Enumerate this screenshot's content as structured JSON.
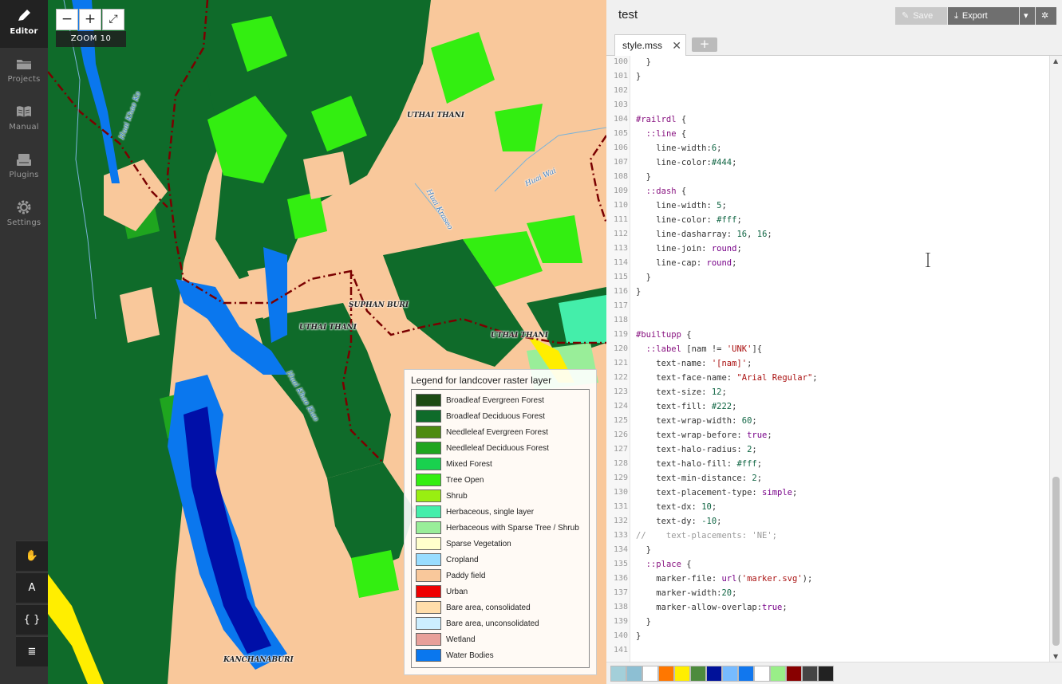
{
  "sidebar": {
    "items": [
      {
        "label": "Editor",
        "icon": "pencil-icon",
        "active": true
      },
      {
        "label": "Projects",
        "icon": "folder-icon",
        "active": false
      },
      {
        "label": "Manual",
        "icon": "book-icon",
        "active": false
      },
      {
        "label": "Plugins",
        "icon": "plugin-icon",
        "active": false
      },
      {
        "label": "Settings",
        "icon": "gear-icon",
        "active": false
      }
    ],
    "tools": [
      {
        "icon": "hand-icon",
        "glyph": "✋"
      },
      {
        "icon": "font-icon",
        "glyph": "A"
      },
      {
        "icon": "braces-icon",
        "glyph": "{ }"
      },
      {
        "icon": "layers-icon",
        "glyph": "≣"
      }
    ]
  },
  "map": {
    "zoom_out": "−",
    "zoom_in": "+",
    "fullscreen": "⤢",
    "zoom_label": "ZOOM 10",
    "labels": [
      {
        "text": "UTHAI THANI",
        "kind": "place"
      },
      {
        "text": "SUPHAN BURI",
        "kind": "place"
      },
      {
        "text": "UTHAI THANI",
        "kind": "place"
      },
      {
        "text": "UTHAI THANI",
        "kind": "place"
      },
      {
        "text": "KANCHANABURI",
        "kind": "place"
      },
      {
        "text": "Huai Wai",
        "kind": "river"
      },
      {
        "text": "Huai Khao Ko",
        "kind": "river"
      },
      {
        "text": "Huai Khao Kiao",
        "kind": "river"
      },
      {
        "text": "Huai Kraseo",
        "kind": "river"
      }
    ],
    "legend": {
      "title": "Legend for landcover raster layer",
      "items": [
        {
          "label": "Broadleaf Evergreen Forest",
          "color": "#1d4a12"
        },
        {
          "label": "Broadleaf Deciduous Forest",
          "color": "#0f6b2a"
        },
        {
          "label": "Needleleaf Evergreen Forest",
          "color": "#4d8b10"
        },
        {
          "label": "Needleleaf Deciduous Forest",
          "color": "#1fa51f"
        },
        {
          "label": "Mixed Forest",
          "color": "#19d14e"
        },
        {
          "label": "Tree Open",
          "color": "#33ee11"
        },
        {
          "label": "Shrub",
          "color": "#99ee11"
        },
        {
          "label": "Herbaceous, single layer",
          "color": "#44eeaa"
        },
        {
          "label": "Herbaceous with Sparse Tree / Shrub",
          "color": "#99ee99"
        },
        {
          "label": "Sparse Vegetation",
          "color": "#ffffcc"
        },
        {
          "label": "Cropland",
          "color": "#99ddff"
        },
        {
          "label": "Paddy field",
          "color": "#f9c89b"
        },
        {
          "label": "Urban",
          "color": "#ee0000"
        },
        {
          "label": "Bare area, consolidated",
          "color": "#ffddaa"
        },
        {
          "label": "Bare area, unconsolidated",
          "color": "#cceeff"
        },
        {
          "label": "Wetland",
          "color": "#e8a09a"
        },
        {
          "label": "Water Bodies",
          "color": "#0a77ee"
        }
      ]
    }
  },
  "editor": {
    "project_title": "test",
    "toolbar": {
      "save": "Save",
      "export": "Export"
    },
    "tab_label": "style.mss",
    "tab_close": "✕",
    "tab_add": "+",
    "lines": [
      {
        "n": "100",
        "html": "  }"
      },
      {
        "n": "101",
        "html": "}"
      },
      {
        "n": "102",
        "html": ""
      },
      {
        "n": "103",
        "html": ""
      },
      {
        "n": "104",
        "html": "<span class=\"sel\">#railrdl</span> {"
      },
      {
        "n": "105",
        "html": "  <span class=\"sel\">::line</span> {"
      },
      {
        "n": "106",
        "html": "    line-width:<span class=\"num\">6</span>;"
      },
      {
        "n": "107",
        "html": "    line-color:<span class=\"num\">#444</span>;"
      },
      {
        "n": "108",
        "html": "  }"
      },
      {
        "n": "109",
        "html": "  <span class=\"sel\">::dash</span> {"
      },
      {
        "n": "110",
        "html": "    line-width: <span class=\"num\">5</span>;"
      },
      {
        "n": "111",
        "html": "    line-color: <span class=\"num\">#fff</span>;"
      },
      {
        "n": "112",
        "html": "    line-dasharray: <span class=\"num\">16</span>, <span class=\"num\">16</span>;"
      },
      {
        "n": "113",
        "html": "    line-join: <span class=\"kw\">round</span>;"
      },
      {
        "n": "114",
        "html": "    line-cap: <span class=\"kw\">round</span>;"
      },
      {
        "n": "115",
        "html": "  }"
      },
      {
        "n": "116",
        "html": "}"
      },
      {
        "n": "117",
        "html": ""
      },
      {
        "n": "118",
        "html": ""
      },
      {
        "n": "119",
        "html": "<span class=\"sel\">#builtupp</span> {"
      },
      {
        "n": "120",
        "html": "  <span class=\"sel\">::label</span> [nam != <span class=\"str\">'UNK'</span>]{"
      },
      {
        "n": "121",
        "html": "    text-name: <span class=\"str\">'[nam]'</span>;"
      },
      {
        "n": "122",
        "html": "    text-face-name: <span class=\"str\">\"Arial Regular\"</span>;"
      },
      {
        "n": "123",
        "html": "    text-size: <span class=\"num\">12</span>;"
      },
      {
        "n": "124",
        "html": "    text-fill: <span class=\"num\">#222</span>;"
      },
      {
        "n": "125",
        "html": "    text-wrap-width: <span class=\"num\">60</span>;"
      },
      {
        "n": "126",
        "html": "    text-wrap-before: <span class=\"kw\">true</span>;"
      },
      {
        "n": "127",
        "html": "    text-halo-radius: <span class=\"num\">2</span>;"
      },
      {
        "n": "128",
        "html": "    text-halo-fill: <span class=\"num\">#fff</span>;"
      },
      {
        "n": "129",
        "html": "    text-min-distance: <span class=\"num\">2</span>;"
      },
      {
        "n": "130",
        "html": "    text-placement-type: <span class=\"kw\">simple</span>;"
      },
      {
        "n": "131",
        "html": "    text-dx: <span class=\"num\">10</span>;"
      },
      {
        "n": "132",
        "html": "    text-dy: <span class=\"num\">-10</span>;"
      },
      {
        "n": "133",
        "html": "<span class=\"cm\">//    text-placements: 'NE';</span>"
      },
      {
        "n": "134",
        "html": "  }"
      },
      {
        "n": "135",
        "html": "  <span class=\"sel\">::place</span> {"
      },
      {
        "n": "136",
        "html": "    marker-file: <span class=\"kw\">url</span>(<span class=\"str\">'marker.svg'</span>);"
      },
      {
        "n": "137",
        "html": "    marker-width:<span class=\"num\">20</span>;"
      },
      {
        "n": "138",
        "html": "    marker-allow-overlap:<span class=\"kw\">true</span>;"
      },
      {
        "n": "139",
        "html": "  }"
      },
      {
        "n": "140",
        "html": "}"
      },
      {
        "n": "141",
        "html": ""
      }
    ],
    "palette": [
      "#a3cfd9",
      "#8dbfd3",
      "#ffffff",
      "#ff7700",
      "#ffee00",
      "#4d8b3d",
      "#001199",
      "#77bbff",
      "#1177ee",
      "#ffffff",
      "#99ee88",
      "#880000",
      "#444444",
      "#222222"
    ]
  }
}
